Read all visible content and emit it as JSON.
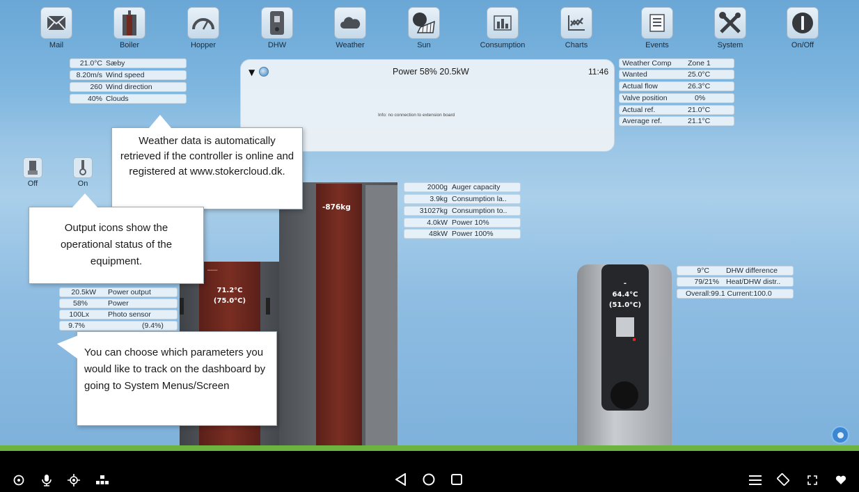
{
  "top_icons": [
    {
      "label": "Mail",
      "icon": "mail-icon"
    },
    {
      "label": "Boiler",
      "icon": "boiler-icon"
    },
    {
      "label": "Hopper",
      "icon": "hopper-gauge-icon"
    },
    {
      "label": "DHW",
      "icon": "dhw-tank-icon"
    },
    {
      "label": "Weather",
      "icon": "cloud-icon"
    },
    {
      "label": "Sun",
      "icon": "sun-panel-icon"
    },
    {
      "label": "Consumption",
      "icon": "bar-chart-icon"
    },
    {
      "label": "Charts",
      "icon": "line-chart-icon"
    },
    {
      "label": "Events",
      "icon": "events-list-icon"
    },
    {
      "label": "System",
      "icon": "tools-icon"
    },
    {
      "label": "On/Off",
      "icon": "power-icon"
    }
  ],
  "weather": [
    {
      "value": "21.0°C",
      "name": "Sæby"
    },
    {
      "value": "8.20m/s",
      "name": "Wind speed"
    },
    {
      "value": "260",
      "name": "Wind direction"
    },
    {
      "value": "40%",
      "name": "Clouds"
    }
  ],
  "panel": {
    "status": "Power 58% 20.5kW",
    "time": "11:46",
    "info": "Info: no connection to extension board"
  },
  "weather_comp": [
    {
      "name": "Weather Comp",
      "value": "Zone 1"
    },
    {
      "name": "Wanted",
      "value": "25.0°C"
    },
    {
      "name": "Actual flow",
      "value": "26.3°C"
    },
    {
      "name": "Valve position",
      "value": "0%"
    },
    {
      "name": "Actual ref.",
      "value": "21.0°C"
    },
    {
      "name": "Average ref.",
      "value": "21.1°C"
    }
  ],
  "outputs": [
    {
      "label": "Off"
    },
    {
      "label": "On"
    }
  ],
  "hopper": {
    "level": "-876kg",
    "rows": [
      {
        "value": "2000g",
        "name": "Auger capacity"
      },
      {
        "value": "3.9kg",
        "name": "Consumption la.."
      },
      {
        "value": "31027kg",
        "name": "Consumption to.."
      },
      {
        "value": "4.0kW",
        "name": "Power 10%"
      },
      {
        "value": "48kW",
        "name": "Power 100%"
      }
    ]
  },
  "boiler": {
    "temp": "71.2°C",
    "wanted": "(75.0°C)",
    "rows": [
      {
        "value": "20.5kW",
        "name": "Power output"
      },
      {
        "value": "58%",
        "name": "Power"
      },
      {
        "value": "100Lx",
        "name": "Photo sensor"
      },
      {
        "value": "9.7%",
        "name": "(9.4%)"
      }
    ]
  },
  "dhw": {
    "top": "-",
    "temp": "64.4°C",
    "wanted": "(51.0°C)",
    "rows": [
      {
        "value": "9°C",
        "name": "DHW difference"
      },
      {
        "value": "79/21%",
        "name": "Heat/DHW distr.."
      },
      {
        "value": "",
        "name": "Overall:99.1 Current:100.0"
      }
    ]
  },
  "callouts": {
    "weather": "Weather data is automatically retrieved if the controller is online and registered at www.stokercloud.dk.",
    "output": "Output icons show the operational status of the equipment.",
    "params": "You can choose which parameters you would like to track on the dashboard by going to System Menus/Screen"
  },
  "colors": {
    "boiler_red": "#6e2a20",
    "grey_body": "#5c5f64",
    "ground": "#6db33f"
  }
}
